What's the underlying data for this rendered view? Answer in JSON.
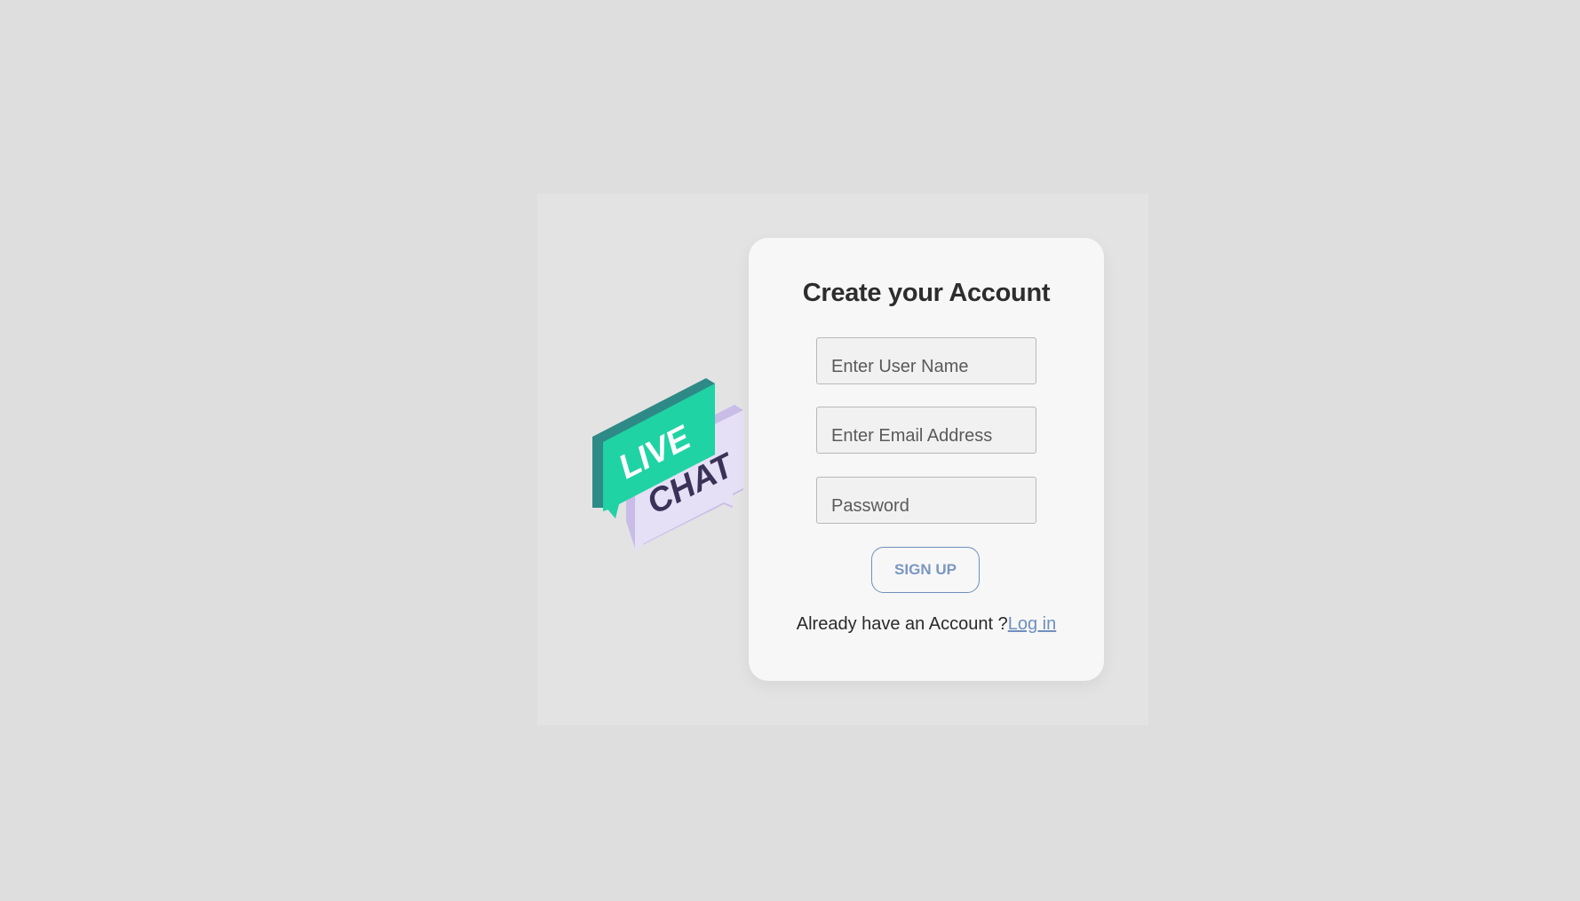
{
  "logo": {
    "word1": "LIVE",
    "word2": "CHAT",
    "colors": {
      "green": "#1fd3a4",
      "green_side": "#2e8a86",
      "lavender": "#e6e0f6",
      "lavender_side": "#c9bde8",
      "chat_text": "#3a3358"
    }
  },
  "form": {
    "title": "Create your Account",
    "username_placeholder": "Enter User Name",
    "email_placeholder": "Enter Email Address",
    "password_placeholder": "Password",
    "submit_label": "SIGN UP",
    "login_prompt": "Already have an Account ?",
    "login_link": "Log in"
  }
}
